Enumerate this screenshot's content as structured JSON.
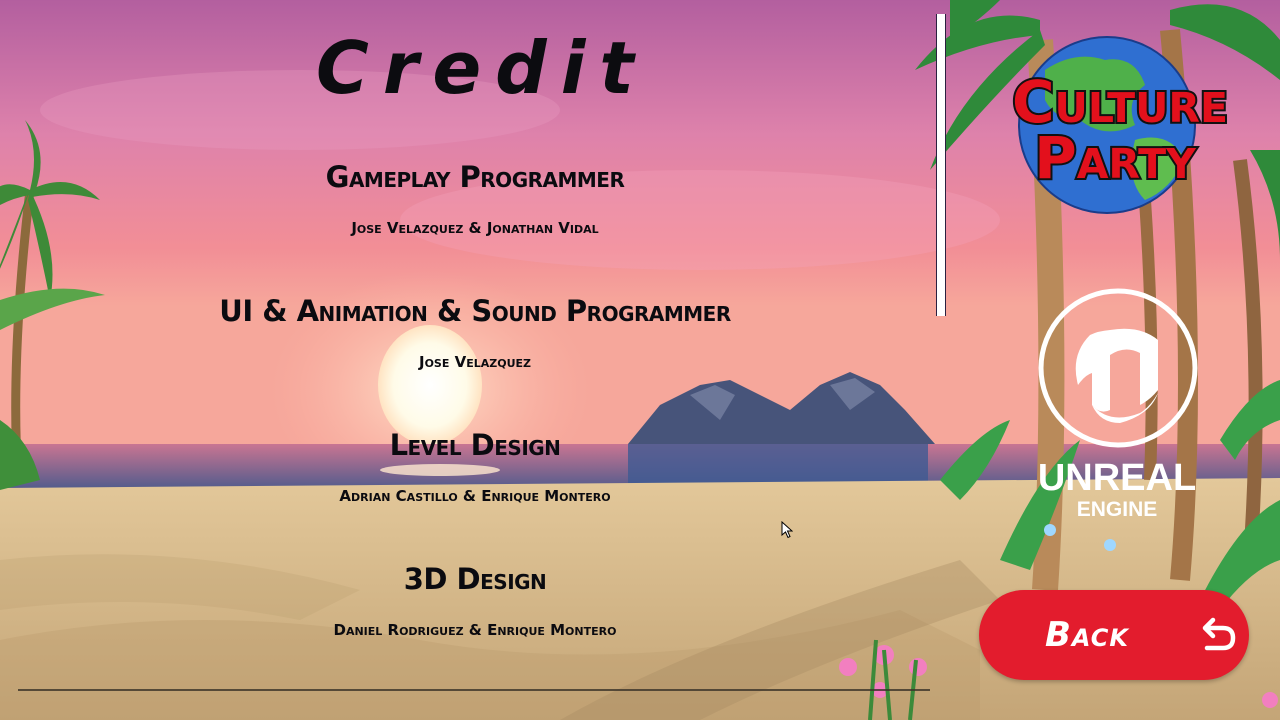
{
  "screen": {
    "title": "Credit",
    "credits": [
      {
        "role": "Gameplay Programmer",
        "names": "Jose Velazquez & Jonathan Vidal"
      },
      {
        "role": "UI & Animation & Sound Programmer",
        "names": "Jose Velazquez"
      },
      {
        "role": "Level Design",
        "names": "Adrian Castillo & Enrique Montero"
      },
      {
        "role": "3D Design",
        "names": "Daniel Rodriguez & Enrique Montero"
      }
    ]
  },
  "logos": {
    "game_logo_line1": "Culture",
    "game_logo_line2": "Party",
    "engine_line1": "UNREAL",
    "engine_line2": "ENGINE"
  },
  "back_button": {
    "label": "Back",
    "icon": "return-arrow-icon"
  },
  "icons": {
    "engine_mark": "unreal-logo-icon",
    "pointer": "mouse-cursor-icon"
  },
  "colors": {
    "back_button": "#e31c2d",
    "logo_red": "#e3101c",
    "text_dark": "#0b0b10",
    "sky_top": "#b75fa0",
    "sand": "#d8bb8a"
  }
}
